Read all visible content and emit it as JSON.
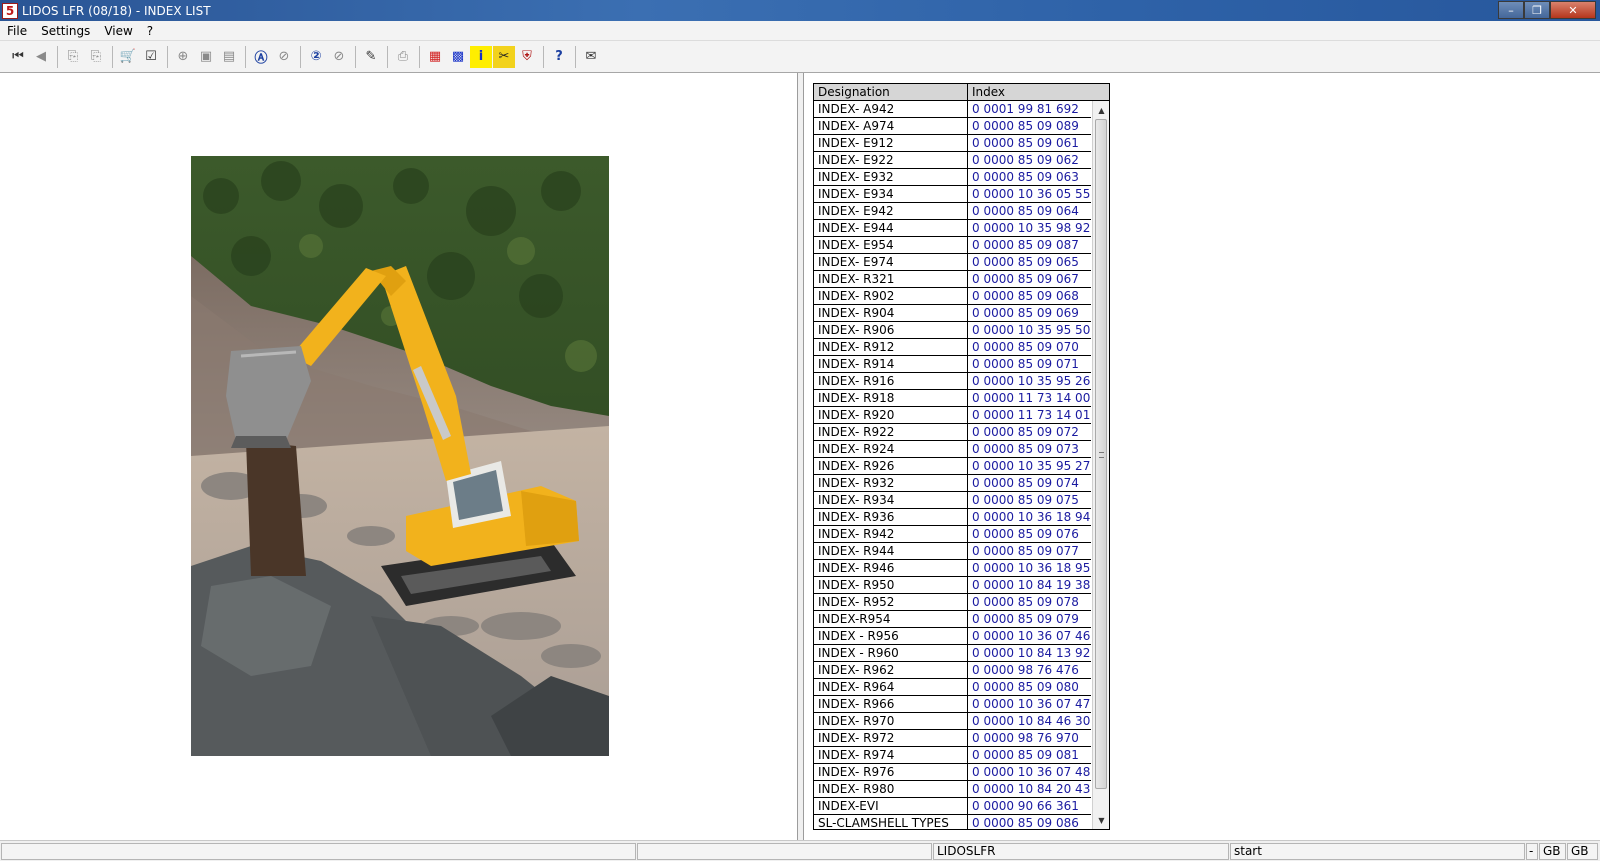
{
  "window": {
    "title": "LIDOS LFR (08/18) - INDEX LIST",
    "app_icon_glyph": "5",
    "minimize_glyph": "–",
    "maximize_glyph": "❐",
    "close_glyph": "✕"
  },
  "menu": [
    "File",
    "Settings",
    "View",
    "?"
  ],
  "toolbar": {
    "buttons": [
      {
        "icon": "first-page-icon",
        "glyph": "⏮"
      },
      {
        "icon": "back-icon",
        "glyph": "◀"
      },
      {
        "icon": "prev-document-icon",
        "glyph": "⎘"
      },
      {
        "icon": "next-document-icon",
        "glyph": "⎘"
      },
      {
        "icon": "cart-icon",
        "glyph": "🛒"
      },
      {
        "icon": "checklist-icon",
        "glyph": "☑"
      },
      {
        "icon": "zoom-in-icon",
        "glyph": "⊕"
      },
      {
        "icon": "fit-page-icon",
        "glyph": "▣"
      },
      {
        "icon": "fit-width-icon",
        "glyph": "▤"
      },
      {
        "icon": "search-a-icon",
        "glyph": "Ⓐ"
      },
      {
        "icon": "search-reset-a-icon",
        "glyph": "⊘"
      },
      {
        "icon": "search-2-icon",
        "glyph": "②"
      },
      {
        "icon": "search-reset-2-icon",
        "glyph": "⊘"
      },
      {
        "icon": "edit-note-icon",
        "glyph": "✎"
      },
      {
        "icon": "print-icon",
        "glyph": "⎙"
      },
      {
        "icon": "grid-red-icon",
        "glyph": "▦"
      },
      {
        "icon": "grid-blue-icon",
        "glyph": "▩"
      },
      {
        "icon": "info-icon",
        "glyph": "i"
      },
      {
        "icon": "tools-icon",
        "glyph": "✂"
      },
      {
        "icon": "shield-icon",
        "glyph": "⛨"
      },
      {
        "icon": "lidos-help-icon",
        "glyph": "?"
      },
      {
        "icon": "mail-icon",
        "glyph": "✉"
      }
    ]
  },
  "table": {
    "headers": {
      "designation": "Designation",
      "index": "Index"
    },
    "rows": [
      {
        "designation": "INDEX- A942",
        "index": "0 0001 99 81 692"
      },
      {
        "designation": "INDEX- A974",
        "index": "0 0000 85 09 089"
      },
      {
        "designation": "INDEX- E912",
        "index": "0 0000 85 09 061"
      },
      {
        "designation": "INDEX- E922",
        "index": "0 0000 85 09 062"
      },
      {
        "designation": "INDEX- E932",
        "index": "0 0000 85 09 063"
      },
      {
        "designation": "INDEX- E934",
        "index": "0 0000 10 36 05 55"
      },
      {
        "designation": "INDEX- E942",
        "index": "0 0000 85 09 064"
      },
      {
        "designation": "INDEX- E944",
        "index": "0 0000 10 35 98 92"
      },
      {
        "designation": "INDEX- E954",
        "index": "0 0000 85 09 087"
      },
      {
        "designation": "INDEX- E974",
        "index": "0 0000 85 09 065"
      },
      {
        "designation": "INDEX- R321",
        "index": "0 0000 85 09 067"
      },
      {
        "designation": "INDEX- R902",
        "index": "0 0000 85 09 068"
      },
      {
        "designation": "INDEX- R904",
        "index": "0 0000 85 09 069"
      },
      {
        "designation": "INDEX- R906",
        "index": "0 0000 10 35 95 50"
      },
      {
        "designation": "INDEX- R912",
        "index": "0 0000 85 09 070"
      },
      {
        "designation": "INDEX- R914",
        "index": "0 0000 85 09 071"
      },
      {
        "designation": "INDEX- R916",
        "index": "0 0000 10 35 95 26"
      },
      {
        "designation": "INDEX- R918",
        "index": "0 0000 11 73 14 00"
      },
      {
        "designation": "INDEX- R920",
        "index": "0 0000 11 73 14 01"
      },
      {
        "designation": "INDEX- R922",
        "index": "0 0000 85 09 072"
      },
      {
        "designation": "INDEX- R924",
        "index": "0 0000 85 09 073"
      },
      {
        "designation": "INDEX- R926",
        "index": "0 0000 10 35 95 27"
      },
      {
        "designation": "INDEX- R932",
        "index": "0 0000 85 09 074"
      },
      {
        "designation": "INDEX- R934",
        "index": "0 0000 85 09 075"
      },
      {
        "designation": "INDEX- R936",
        "index": "0 0000 10 36 18 94"
      },
      {
        "designation": "INDEX- R942",
        "index": "0 0000 85 09 076"
      },
      {
        "designation": "INDEX- R944",
        "index": "0 0000 85 09 077"
      },
      {
        "designation": "INDEX- R946",
        "index": "0 0000 10 36 18 95"
      },
      {
        "designation": "INDEX- R950",
        "index": "0 0000 10 84 19 38"
      },
      {
        "designation": "INDEX- R952",
        "index": "0 0000 85 09 078"
      },
      {
        "designation": "INDEX-R954",
        "index": "0 0000 85 09 079"
      },
      {
        "designation": "INDEX - R956",
        "index": "0 0000 10 36 07 46"
      },
      {
        "designation": "INDEX - R960",
        "index": "0 0000 10 84 13 92"
      },
      {
        "designation": "INDEX- R962",
        "index": "0 0000 98 76 476"
      },
      {
        "designation": "INDEX- R964",
        "index": "0 0000 85 09 080"
      },
      {
        "designation": "INDEX- R966",
        "index": "0 0000 10 36 07 47"
      },
      {
        "designation": "INDEX- R970",
        "index": "0 0000 10 84 46 30"
      },
      {
        "designation": "INDEX- R972",
        "index": "0 0000 98 76 970"
      },
      {
        "designation": "INDEX- R974",
        "index": "0 0000 85 09 081"
      },
      {
        "designation": "INDEX- R976",
        "index": "0 0000 10 36 07 48"
      },
      {
        "designation": "INDEX- R980",
        "index": "0 0000 10 84 20 43"
      },
      {
        "designation": "INDEX-EVI",
        "index": "0 0000 90 66 361"
      },
      {
        "designation": "SL-CLAMSHELL TYPES",
        "index": "0 0000 85 09 086"
      }
    ]
  },
  "scrollbar": {
    "up_glyph": "▲",
    "down_glyph": "▼"
  },
  "statusbar": {
    "app": "LIDOSLFR",
    "mode": "start",
    "dash": "-",
    "lang1": "GB",
    "lang2": "GB"
  },
  "colors": {
    "index_text": "#1a1aa0",
    "machine_yellow": "#f2b21c"
  }
}
